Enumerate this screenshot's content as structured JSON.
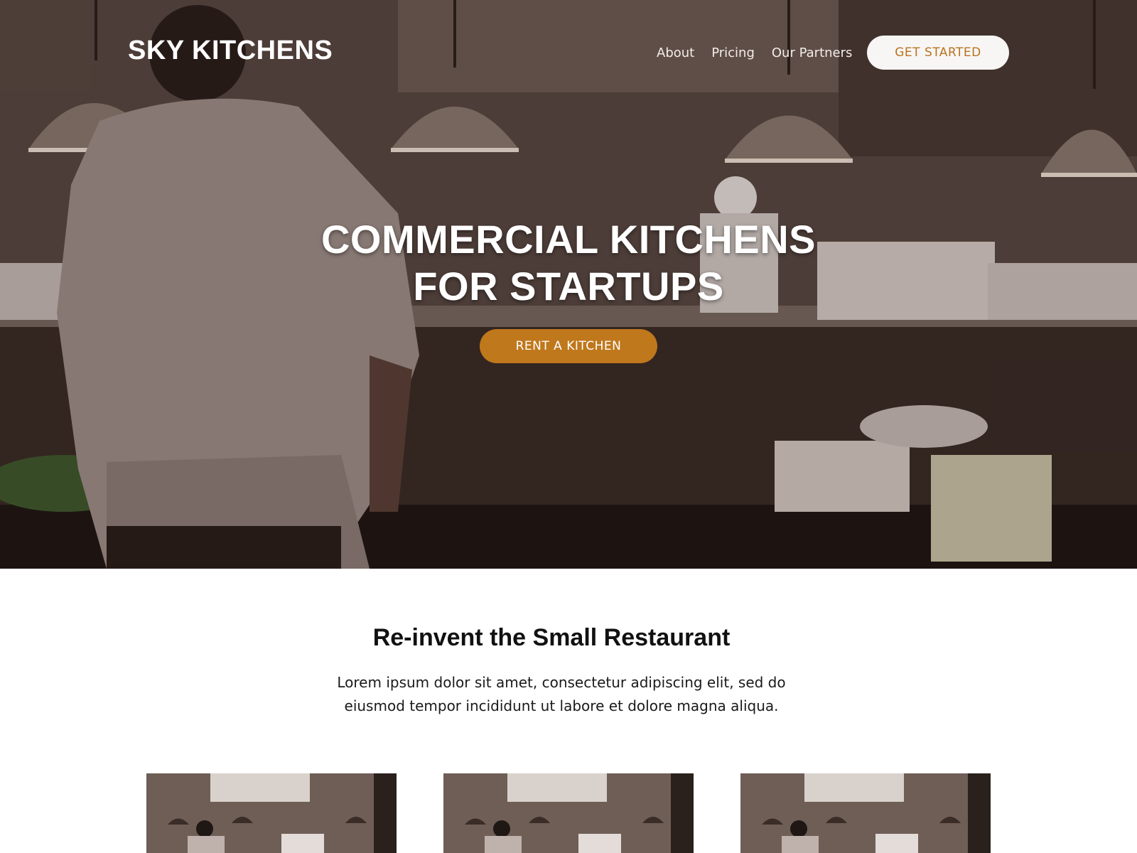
{
  "header": {
    "brand": "SKY KITCHENS",
    "nav": [
      {
        "label": "About"
      },
      {
        "label": "Pricing"
      },
      {
        "label": "Our Partners"
      }
    ],
    "cta_label": "GET STARTED"
  },
  "hero": {
    "title_line1": "COMMERCIAL KITCHENS",
    "title_line2": "FOR STARTUPS",
    "button_label": "RENT A KITCHEN"
  },
  "intro": {
    "heading": "Re-invent the Small Restaurant",
    "text": "Lorem ipsum dolor sit amet, consectetur adipiscing elit, sed do eiusmod tempor incididunt ut labore et dolore magna aliqua."
  },
  "cards": [
    {
      "image": "kitchen-photo"
    },
    {
      "image": "kitchen-photo"
    },
    {
      "image": "kitchen-photo"
    }
  ],
  "colors": {
    "accent": "#c0781c",
    "accent_text": "#b9731e",
    "button_light": "#f8f6f5"
  }
}
